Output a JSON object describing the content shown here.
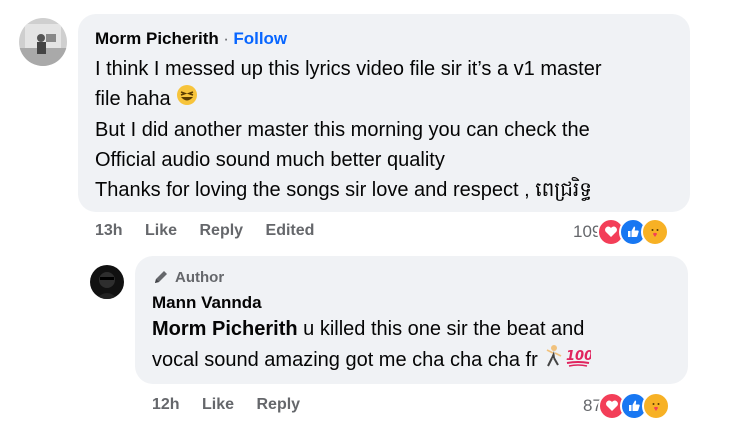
{
  "comment": {
    "author": "Morm Picherith",
    "separator": "·",
    "follow_label": "Follow",
    "lines": [
      "I think I messed up this lyrics video file sir it’s a v1 master",
      "file haha",
      "But I did another master this morning you can check the",
      "Official audio sound much better quality",
      "Thanks for loving the songs sir love and respect , ពេជ្ររិទ្ធ"
    ],
    "time": "13h",
    "like_label": "Like",
    "reply_label": "Reply",
    "edited_label": "Edited",
    "reaction_count": "109",
    "reactions": [
      "love",
      "like",
      "care"
    ]
  },
  "reply": {
    "badge_label": "Author",
    "author": "Mann Vannda",
    "mention": "Morm Picherith",
    "line1": " u killed this one sir the beat and",
    "line2": "vocal sound amazing got me cha cha cha fr",
    "time": "12h",
    "like_label": "Like",
    "reply_label": "Reply",
    "reaction_count": "87",
    "reactions": [
      "love",
      "like",
      "care"
    ]
  },
  "colors": {
    "bubble": "#f0f2f5",
    "follow": "#0866ff",
    "secondary_text": "#65676b",
    "love": "#f33e58",
    "like": "#1877f2",
    "care": "#f7b125"
  }
}
